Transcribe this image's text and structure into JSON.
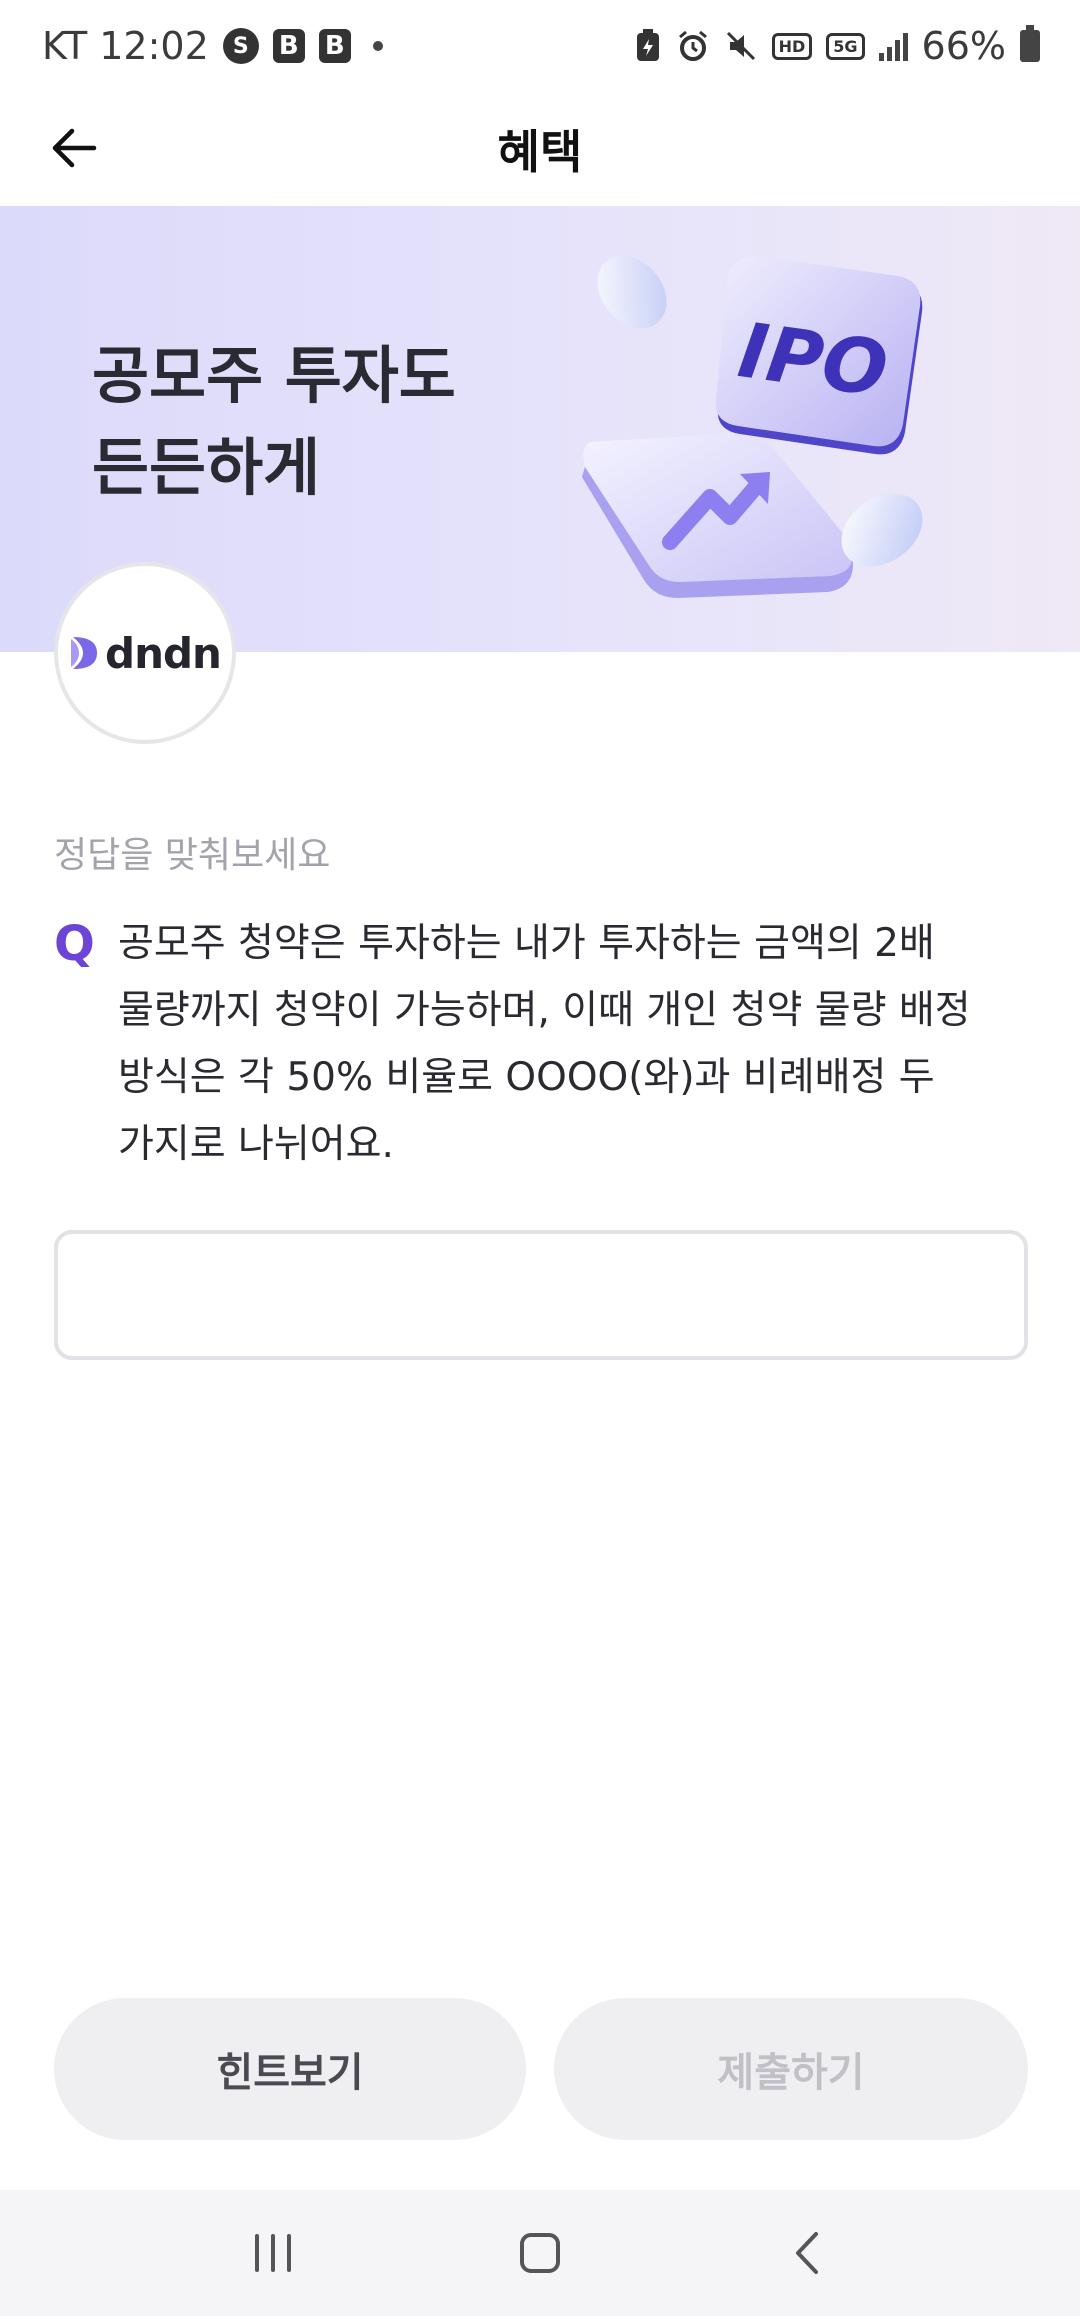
{
  "status_bar": {
    "carrier_time": "KT 12:02",
    "battery": "66%",
    "icons": [
      "s-circle-icon",
      "b-app-icon",
      "b-app-icon",
      "dot-icon",
      "battery-saver-icon",
      "alarm-icon",
      "mute-icon",
      "hd-icon",
      "5g-icon",
      "signal-icon",
      "battery-icon"
    ],
    "badge_s": "S",
    "badge_b": "B",
    "hd_label": "HD",
    "net_label": "5G"
  },
  "header": {
    "title": "혜택"
  },
  "banner": {
    "title_line1": "공모주 투자도",
    "title_line2": "든든하게",
    "card_label": "IPO",
    "background_colors": [
      "#dcdafa",
      "#efe9f6"
    ]
  },
  "logo": {
    "text": "dndn"
  },
  "quiz": {
    "prompt": "정답을 맞춰보세요",
    "q_mark": "Q",
    "question": "공모주 청약은 투자하는 내가 투자하는 금액의 2배 물량까지 청약이 가능하며, 이때 개인 청약 물량 배정 방식은 각 50% 비율로 OOOO(와)과 비례배정 두 가지로 나뉘어요.",
    "answer_value": "",
    "accent_color": "#6c45d6"
  },
  "actions": {
    "hint_label": "힌트보기",
    "submit_label": "제출하기"
  },
  "nav_bar": {
    "icons": [
      "recent-apps-icon",
      "home-icon",
      "back-nav-icon"
    ]
  }
}
